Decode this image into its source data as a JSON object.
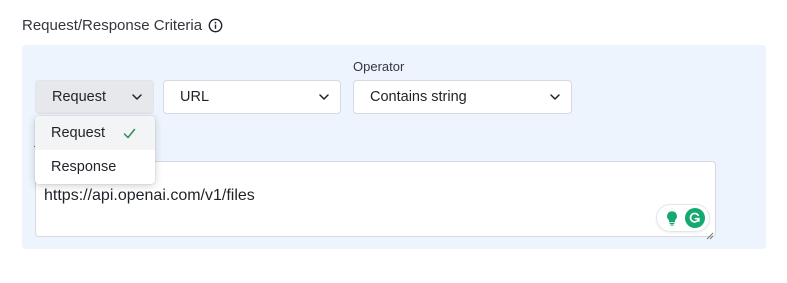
{
  "section": {
    "title": "Request/Response Criteria"
  },
  "filters": {
    "field_type": {
      "value": "Request"
    },
    "field_name": {
      "value": "URL"
    },
    "operator": {
      "label": "Operator",
      "value": "Contains string"
    }
  },
  "dropdown": {
    "options": [
      {
        "label": "Request",
        "selected": true
      },
      {
        "label": "Response",
        "selected": false
      }
    ]
  },
  "value_input": {
    "value": "https://api.openai.com/v1/files"
  },
  "colors": {
    "panel_bg": "#eef4fd",
    "check": "#2e8b57",
    "assist_green": "#15a870"
  },
  "icons": {
    "title_info": "info-icon",
    "chevron": "chevron-down-icon",
    "check": "check-icon",
    "assist_bulb": "lightbulb-icon",
    "assist_g": "grammarly-icon",
    "resize": "resize-handle-icon"
  }
}
